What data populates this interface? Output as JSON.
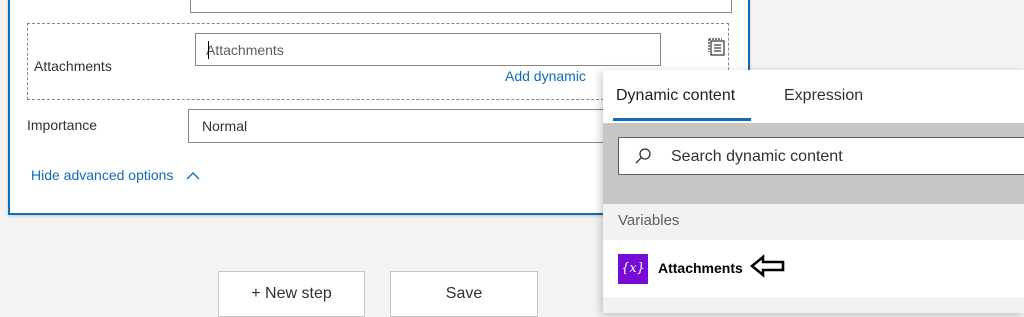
{
  "action": {
    "attachments_label": "Attachments",
    "attachments_placeholder": "Attachments",
    "add_dynamic_link": "Add dynamic",
    "importance_label": "Importance",
    "importance_value": "Normal",
    "hide_advanced": "Hide advanced options",
    "array_icon": "array-mode-icon",
    "chevron_icon": "chevron-up-icon"
  },
  "footer": {
    "new_step": "+ New step",
    "save": "Save"
  },
  "flyout": {
    "tabs": [
      {
        "label": "Dynamic content",
        "selected": true
      },
      {
        "label": "Expression",
        "selected": false
      }
    ],
    "search_placeholder": "Search dynamic content",
    "section_title": "Variables",
    "items": [
      {
        "badge": "{x}",
        "name": "Attachments",
        "badge_color": "#770bd6"
      }
    ]
  },
  "colors": {
    "accent": "#0f6cbd",
    "variable_badge": "#770bd6"
  }
}
